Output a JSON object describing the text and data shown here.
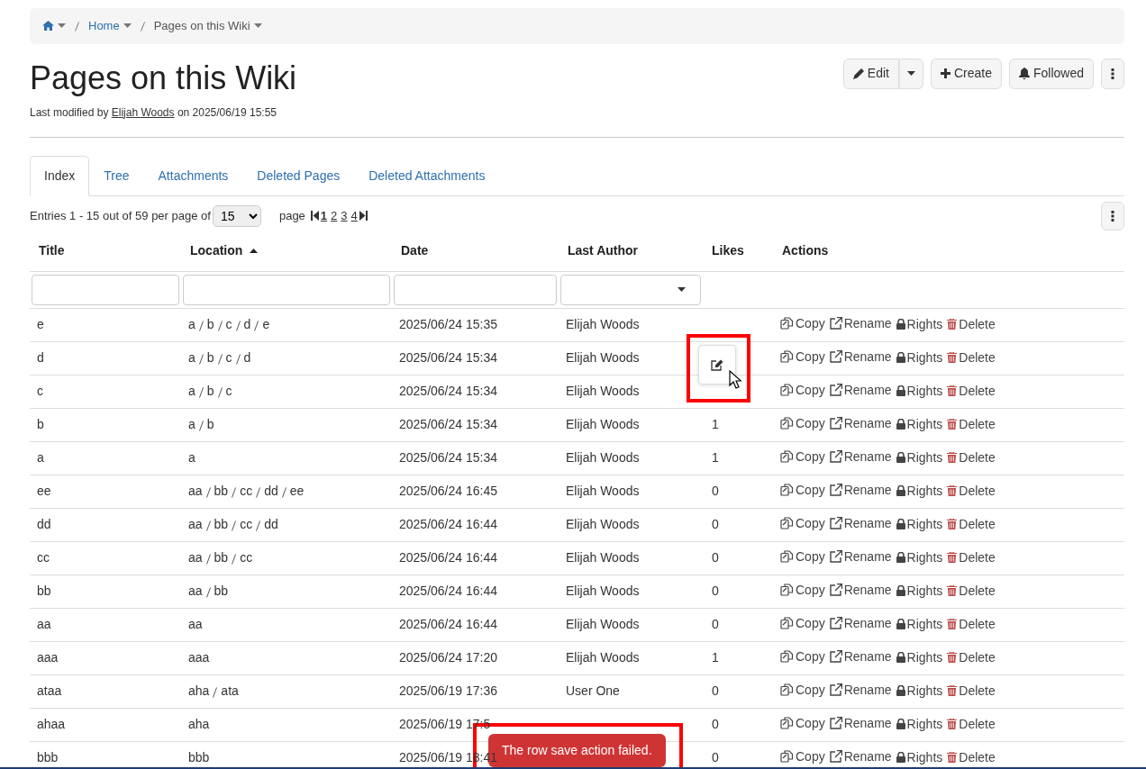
{
  "breadcrumb": [
    {
      "kind": "home"
    },
    {
      "kind": "link",
      "label": "Home"
    },
    {
      "kind": "current",
      "label": "Pages on this Wiki"
    }
  ],
  "page_title": "Pages on this Wiki",
  "modified": {
    "prefix": "Last modified by",
    "author": "Elijah Woods",
    "suffix": "on 2025/06/19 15:55"
  },
  "header_buttons": [
    {
      "kind": "edit",
      "label": "Edit"
    },
    {
      "kind": "create",
      "label": "Create"
    },
    {
      "kind": "followed",
      "label": "Followed"
    },
    {
      "kind": "more"
    }
  ],
  "tabs": [
    {
      "label": "Index",
      "selected": true
    },
    {
      "label": "Tree",
      "selected": false
    },
    {
      "label": "Attachments",
      "selected": false
    },
    {
      "label": "Deleted Pages",
      "selected": false
    },
    {
      "label": "Deleted Attachments",
      "selected": false
    }
  ],
  "paging": {
    "entries": "Entries 1 - 15 out of 59 per page of",
    "per_page": "15",
    "page_label": "page",
    "pages": [
      {
        "label": "1",
        "selected": true
      },
      {
        "label": "2",
        "selected": false
      },
      {
        "label": "3",
        "selected": false
      },
      {
        "label": "4",
        "selected": false
      }
    ]
  },
  "table": {
    "columns": [
      {
        "label": "Title",
        "sorted": false,
        "kind": "text"
      },
      {
        "label": "Location",
        "sorted": true,
        "kind": "text"
      },
      {
        "label": "Date",
        "sorted": false,
        "kind": "text"
      },
      {
        "label": "Last Author",
        "sorted": false,
        "kind": "select"
      },
      {
        "label": "Likes",
        "sorted": false,
        "kind": "plain"
      },
      {
        "label": "Actions",
        "sorted": false,
        "kind": "plain"
      }
    ],
    "rows": [
      {
        "title": "e",
        "location": [
          "a",
          "b",
          "c",
          "d",
          "e"
        ],
        "date": "2025/06/24 15:35",
        "author": "Elijah Woods",
        "actions": [
          "Copy",
          "Rename",
          "Rights",
          "Delete"
        ]
      },
      {
        "title": "d",
        "location": [
          "a",
          "b",
          "c",
          "d"
        ],
        "date": "2025/06/24 15:34",
        "author": "Elijah Woods",
        "actions": [
          "Copy",
          "Rename",
          "Rights",
          "Delete"
        ]
      },
      {
        "title": "c",
        "location": [
          "a",
          "b",
          "c"
        ],
        "date": "2025/06/24 15:34",
        "author": "Elijah Woods",
        "actions": [
          "Copy",
          "Rename",
          "Rights",
          "Delete"
        ]
      },
      {
        "title": "b",
        "location": [
          "a",
          "b"
        ],
        "date": "2025/06/24 15:34",
        "author": "Elijah Woods",
        "likes": "1",
        "actions": [
          "Copy",
          "Rename",
          "Rights",
          "Delete"
        ]
      },
      {
        "title": "a",
        "location": [
          "a"
        ],
        "date": "2025/06/24 15:34",
        "author": "Elijah Woods",
        "likes": "1",
        "actions": [
          "Copy",
          "Rename",
          "Rights",
          "Delete"
        ]
      },
      {
        "title": "ee",
        "location": [
          "aa",
          "bb",
          "cc",
          "dd",
          "ee"
        ],
        "date": "2025/06/24 16:45",
        "author": "Elijah Woods",
        "likes": "0",
        "actions": [
          "Copy",
          "Rename",
          "Rights",
          "Delete"
        ]
      },
      {
        "title": "dd",
        "location": [
          "aa",
          "bb",
          "cc",
          "dd"
        ],
        "date": "2025/06/24 16:44",
        "author": "Elijah Woods",
        "likes": "0",
        "actions": [
          "Copy",
          "Rename",
          "Rights",
          "Delete"
        ]
      },
      {
        "title": "cc",
        "location": [
          "aa",
          "bb",
          "cc"
        ],
        "date": "2025/06/24 16:44",
        "author": "Elijah Woods",
        "likes": "0",
        "actions": [
          "Copy",
          "Rename",
          "Rights",
          "Delete"
        ]
      },
      {
        "title": "bb",
        "location": [
          "aa",
          "bb"
        ],
        "date": "2025/06/24 16:44",
        "author": "Elijah Woods",
        "likes": "0",
        "actions": [
          "Copy",
          "Rename",
          "Rights",
          "Delete"
        ]
      },
      {
        "title": "aa",
        "location": [
          "aa"
        ],
        "date": "2025/06/24 16:44",
        "author": "Elijah Woods",
        "likes": "0",
        "actions": [
          "Copy",
          "Rename",
          "Rights",
          "Delete"
        ]
      },
      {
        "title": "aaa",
        "location": [
          "aaa"
        ],
        "date": "2025/06/24 17:20",
        "author": "Elijah Woods",
        "likes": "1",
        "actions": [
          "Copy",
          "Rename",
          "Rights",
          "Delete"
        ]
      },
      {
        "title": "ataa",
        "location": [
          "aha",
          "ata"
        ],
        "date": "2025/06/19 17:36",
        "author": "User One",
        "likes": "0",
        "actions": [
          "Copy",
          "Rename",
          "Rights",
          "Delete"
        ]
      },
      {
        "title": "ahaa",
        "location": [
          "aha"
        ],
        "date": "2025/06/19 17:5",
        "likes": "0",
        "actions": [
          "Copy",
          "Rename",
          "Rights",
          "Delete"
        ]
      },
      {
        "title": "bbb",
        "location": [
          "bbb"
        ],
        "date": "2025/06/19 18:41",
        "likes": "0",
        "actions": [
          "Copy",
          "Rename",
          "Rights",
          "Delete"
        ]
      }
    ]
  },
  "toast": {
    "message": "The row save action failed."
  }
}
